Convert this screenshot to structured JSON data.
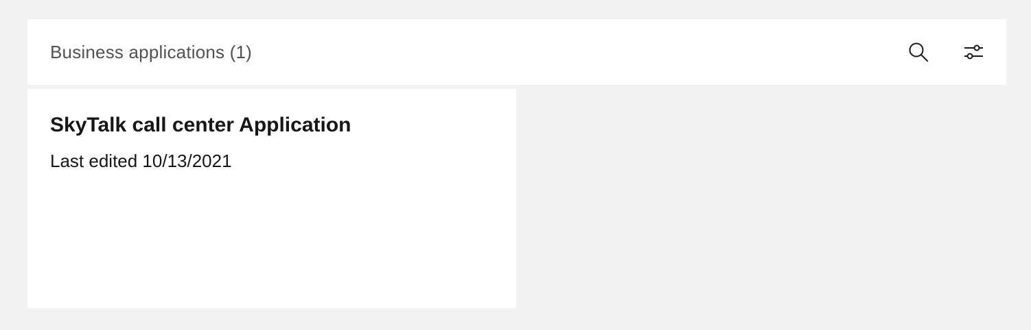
{
  "toolbar": {
    "title": "Business applications (1)",
    "search_icon": "search-icon",
    "filter_icon": "settings-adjust-icon"
  },
  "cards": [
    {
      "title": "SkyTalk call center Application",
      "meta": "Last edited 10/13/2021"
    }
  ],
  "colors": {
    "background": "#f2f2f2",
    "surface": "#ffffff",
    "title_text": "#161616",
    "secondary_text": "#525252"
  }
}
